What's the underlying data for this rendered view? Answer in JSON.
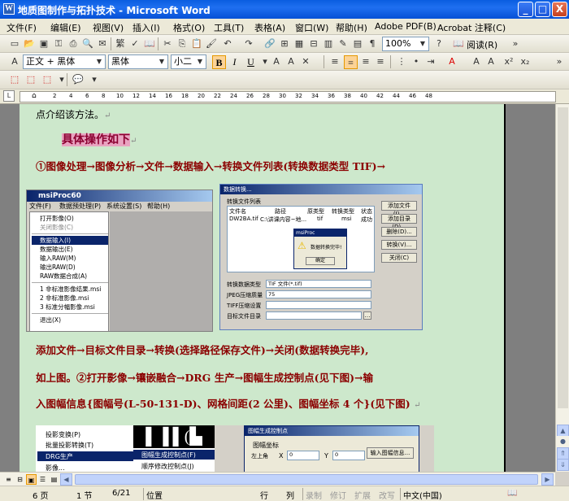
{
  "window": {
    "title": "地质图制作与拓扑技术 - Microsoft Word",
    "buttons": {
      "minimize": "_",
      "maximize": "□",
      "close": "X"
    }
  },
  "menubar": {
    "items": [
      "文件(F)",
      "编辑(E)",
      "视图(V)",
      "插入(I)",
      "格式(O)",
      "工具(T)",
      "表格(A)",
      "窗口(W)",
      "帮助(H)",
      "Adobe PDF(B)",
      "Acrobat 注释(C)"
    ]
  },
  "standard_toolbar": {
    "zoom": "100%",
    "read_label": "阅读(R)"
  },
  "formatting_toolbar": {
    "style": "正文 + 黑体",
    "font": "黑体",
    "size": "小二",
    "bold": "B",
    "italic": "I",
    "underline": "U"
  },
  "ruler": {
    "numbers": [
      "2",
      "4",
      "6",
      "8",
      "10",
      "12",
      "14",
      "16",
      "18",
      "20",
      "22",
      "24",
      "26",
      "28",
      "30",
      "32",
      "34",
      "36",
      "38",
      "40",
      "42",
      "44",
      "46",
      "48"
    ]
  },
  "document": {
    "line1": "点介绍该方法。",
    "heading": "具体操作如下",
    "step1": "①图像处理→图像分析→文件→数据输入→转换文件列表(转换数据类型 TIF)→",
    "para2_line1": "添加文件→目标文件目录→转换(选择路径保存文件)→关闭(数据转换完毕),",
    "para2_line2": "如上图。②打开影像→镶嵌融合→DRG 生产→图幅生成控制点(见下图)→输",
    "para2_line3": "入图幅信息{图幅号(L-50-131-D)、网格间距(2 公里)、图幅坐标 4 个}(见下图)",
    "para_mark": "↵"
  },
  "screenshot1": {
    "title": "msiProc60",
    "menu": [
      "文件(F)",
      "数据预处理(P)",
      "系统设置(S)",
      "帮助(H)"
    ],
    "dropdown": [
      "打开影像(O)",
      "关闭影像(C)",
      "数据输入(I)",
      "数据输出(E)",
      "输入RAW(M)",
      "输出RAW(D)",
      "RAW数据合成(A)",
      "1 非标准影像结果.msi",
      "2 非标准影像.msi",
      "3 标准分幅影像.msi",
      "退出(X)"
    ],
    "highlighted": "数据输入(I)"
  },
  "screenshot2": {
    "title": "数据转换...",
    "list_title": "转换文件列表",
    "columns": [
      "文件名",
      "路径",
      "原类型",
      "转换类型",
      "状态"
    ],
    "row": [
      "DW2BA.tif",
      "C:\\讲课内容~地...",
      "tif",
      "msi",
      "成功"
    ],
    "buttons": [
      "添加文件(I)...",
      "添加目录(D)...",
      "删除(D)...",
      "转换(V)...",
      "关闭(C)"
    ],
    "fields": [
      {
        "label": "转换数据类型",
        "value": "TIF 文件(*.tif)"
      },
      {
        "label": "JPEG压缩质量",
        "value": "75"
      },
      {
        "label": "TIFF压缩设置",
        "value": ""
      },
      {
        "label": "目标文件目录",
        "value": ""
      }
    ],
    "popup": {
      "title": "msiProc",
      "message": "数据转换完毕!",
      "ok": "确定"
    }
  },
  "screenshot3": {
    "menu": [
      "投影变换(P)",
      "批量投影转换(T)",
      "DRG生产",
      "图幅生成控制点(F)",
      "顺序修改控制点(J)",
      "影像..."
    ],
    "dialog_title": "图幅生成控制点",
    "group": "图幅坐标",
    "corner": "左上角",
    "x_label": "X",
    "x_value": "0",
    "y_label": "Y",
    "y_value": "0",
    "button": "输入图幅信息..."
  },
  "statusbar": {
    "page": "6 页",
    "section": "1 节",
    "pages": "6/21",
    "position": "位置",
    "line": "行",
    "col": "列",
    "rec": "录制",
    "trk": "修订",
    "ext": "扩展",
    "ovr": "改写",
    "lang": "中文(中国)"
  }
}
